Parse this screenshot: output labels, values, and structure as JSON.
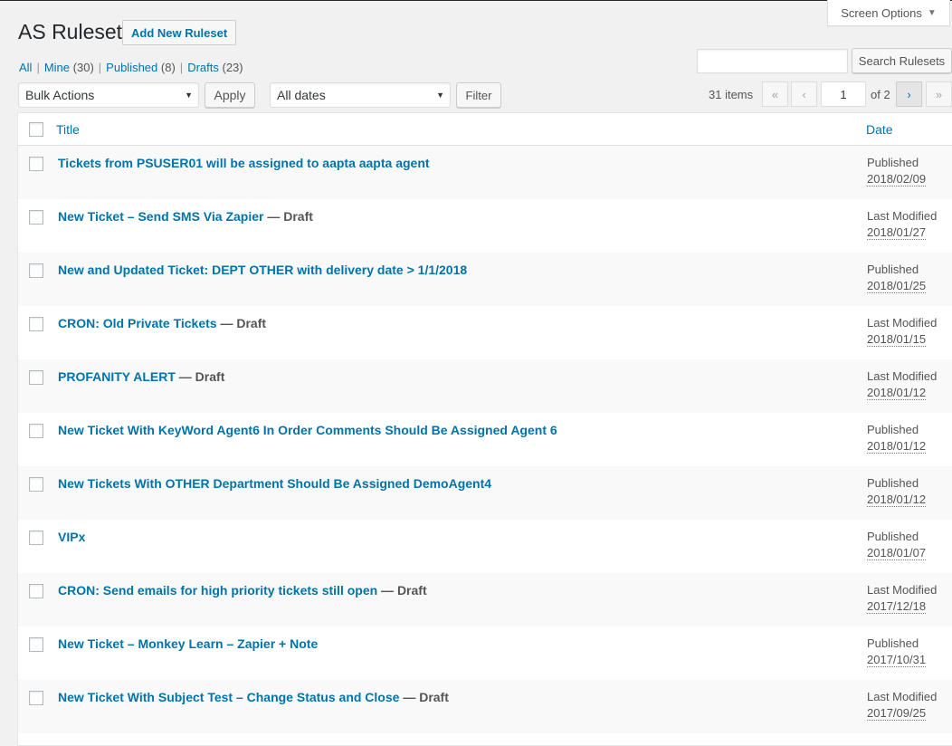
{
  "header": {
    "title": "AS Ruleset",
    "add_new_label": "Add New Ruleset",
    "screen_options_label": "Screen Options"
  },
  "views": [
    {
      "label": "All",
      "count": ""
    },
    {
      "label": "Mine",
      "count": "(30)"
    },
    {
      "label": "Published",
      "count": "(8)"
    },
    {
      "label": "Drafts",
      "count": "(23)"
    }
  ],
  "search": {
    "value": "",
    "button_label": "Search Rulesets"
  },
  "toolbar": {
    "bulk_actions_value": "Bulk Actions",
    "apply_label": "Apply",
    "dates_value": "All dates",
    "filter_label": "Filter"
  },
  "pagination": {
    "items_label": "31 items",
    "current_page": "1",
    "of_pages": "of 2",
    "first_icon": "«",
    "prev_icon": "‹",
    "next_icon": "›",
    "last_icon": "»"
  },
  "table": {
    "columns": {
      "title": "Title",
      "date": "Date"
    },
    "rows": [
      {
        "title": "Tickets from PSUSER01 will be assigned to aapta aapta agent",
        "state": "",
        "status": "Published",
        "date": "2018/02/09"
      },
      {
        "title": "New Ticket – Send SMS Via Zapier",
        "state": " — Draft",
        "status": "Last Modified",
        "date": "2018/01/27"
      },
      {
        "title": "New and Updated Ticket: DEPT OTHER with delivery date > 1/1/2018",
        "state": "",
        "status": "Published",
        "date": "2018/01/25"
      },
      {
        "title": "CRON: Old Private Tickets",
        "state": " — Draft",
        "status": "Last Modified",
        "date": "2018/01/15"
      },
      {
        "title": "PROFANITY ALERT",
        "state": " — Draft",
        "status": "Last Modified",
        "date": "2018/01/12"
      },
      {
        "title": "New Ticket With KeyWord Agent6 In Order Comments Should Be Assigned Agent 6",
        "state": "",
        "status": "Published",
        "date": "2018/01/12"
      },
      {
        "title": "New Tickets With OTHER Department Should Be Assigned DemoAgent4",
        "state": "",
        "status": "Published",
        "date": "2018/01/12"
      },
      {
        "title": "VIPx",
        "state": "",
        "status": "Published",
        "date": "2018/01/07"
      },
      {
        "title": "CRON: Send emails for high priority tickets still open",
        "state": " — Draft",
        "status": "Last Modified",
        "date": "2017/12/18"
      },
      {
        "title": "New Ticket – Monkey Learn – Zapier + Note",
        "state": "",
        "status": "Published",
        "date": "2017/10/31"
      },
      {
        "title": "New Ticket With Subject Test – Change Status and Close",
        "state": " — Draft",
        "status": "Last Modified",
        "date": "2017/09/25"
      }
    ]
  },
  "colors": {
    "link": "#0073aa",
    "background": "#f1f1f1",
    "alt_row": "#f9f9f9"
  }
}
